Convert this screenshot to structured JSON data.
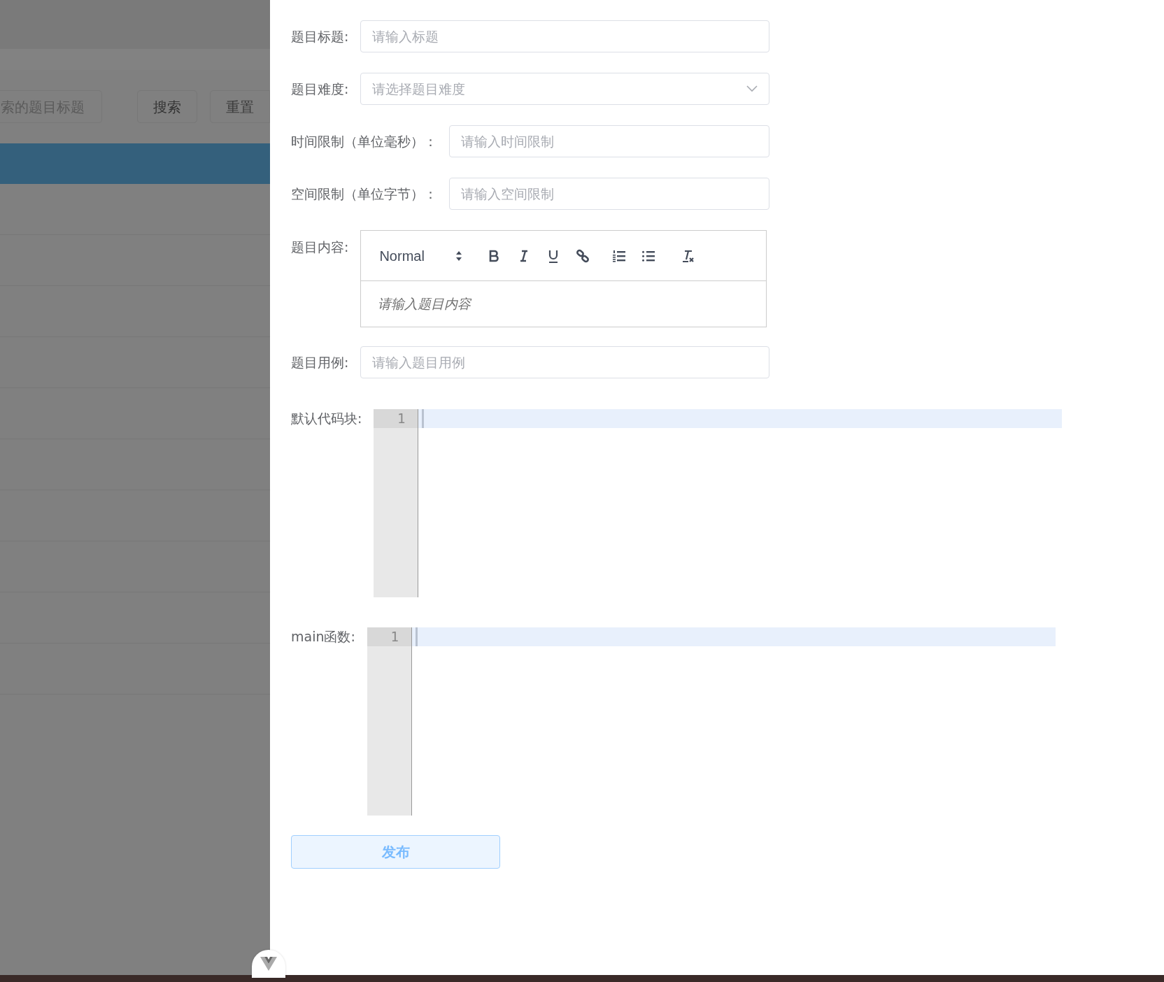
{
  "background": {
    "search": {
      "placeholder": "索的题目标题"
    },
    "buttons": [
      "搜索",
      "重置"
    ]
  },
  "form": {
    "fields": [
      {
        "kind": "input",
        "label": "题目标题:",
        "placeholder": "请输入标题"
      },
      {
        "kind": "select",
        "label": "题目难度:",
        "placeholder": "请选择题目难度"
      },
      {
        "kind": "input",
        "label": "时间限制（单位毫秒）：",
        "placeholder": "请输入时间限制"
      },
      {
        "kind": "input",
        "label": "空间限制（单位字节）：",
        "placeholder": "请输入空间限制"
      },
      {
        "kind": "editor",
        "label": "题目内容:",
        "format": "Normal",
        "placeholder": "请输入题目内容"
      },
      {
        "kind": "input",
        "label": "题目用例:",
        "placeholder": "请输入题目用例"
      },
      {
        "kind": "code",
        "label": "默认代码块:",
        "line_numbers": [
          "1"
        ]
      },
      {
        "kind": "code",
        "label": "main函数:",
        "line_numbers": [
          "1"
        ]
      }
    ],
    "submit": "发布"
  }
}
